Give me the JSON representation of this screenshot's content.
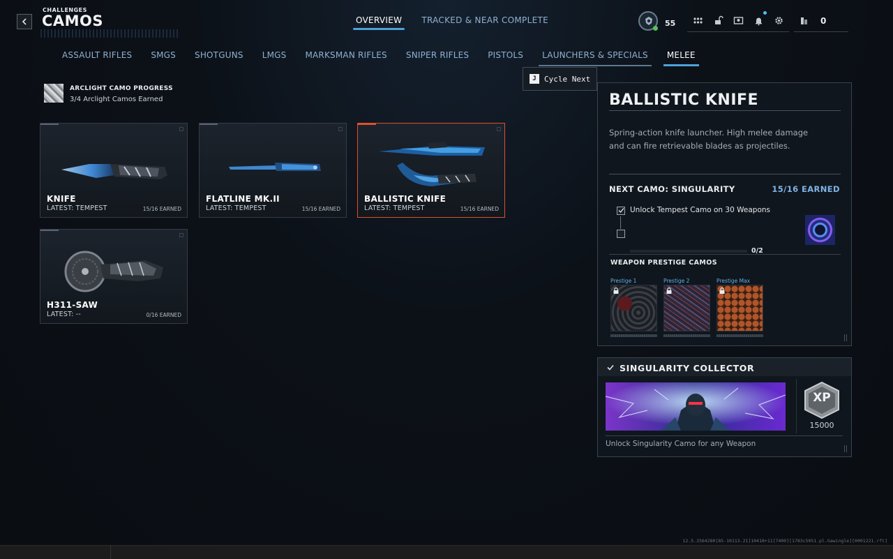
{
  "header": {
    "breadcrumb": "CHALLENGES",
    "title": "CAMOS",
    "tabs": [
      {
        "label": "OVERVIEW",
        "active": true
      },
      {
        "label": "TRACKED & NEAR COMPLETE",
        "active": false
      }
    ],
    "level": "55",
    "currency_count": "0",
    "icons": [
      "rank-emblem-icon",
      "grid-menu-icon",
      "unlock-icon",
      "profile-card-icon",
      "notification-bell-icon",
      "settings-gear-icon",
      "cod-points-icon"
    ]
  },
  "categories": [
    {
      "label": "ASSAULT RIFLES"
    },
    {
      "label": "SMGS"
    },
    {
      "label": "SHOTGUNS"
    },
    {
      "label": "LMGS"
    },
    {
      "label": "MARKSMAN RIFLES"
    },
    {
      "label": "SNIPER RIFLES"
    },
    {
      "label": "PISTOLS"
    },
    {
      "label": "LAUNCHERS & SPECIALS"
    },
    {
      "label": "MELEE",
      "active": true
    }
  ],
  "cycle_tip": {
    "key": "J",
    "label": "Cycle Next"
  },
  "arclight": {
    "title": "ARCLIGHT CAMO PROGRESS",
    "subtitle": "3/4 Arclight Camos Earned"
  },
  "weapons": [
    {
      "name": "KNIFE",
      "latest": "LATEST: TEMPEST",
      "earned": "15/16 EARNED"
    },
    {
      "name": "FLATLINE MK.II",
      "latest": "LATEST: TEMPEST",
      "earned": "15/16 EARNED"
    },
    {
      "name": "BALLISTIC KNIFE",
      "latest": "LATEST: TEMPEST",
      "earned": "15/16 EARNED",
      "selected": true
    },
    {
      "name": "H311-SAW",
      "latest": "LATEST: --",
      "earned": "0/16 EARNED"
    }
  ],
  "detail": {
    "title": "BALLISTIC KNIFE",
    "description": "Spring-action knife launcher. High melee damage and can fire retrievable blades as projectiles.",
    "next_camo": "NEXT CAMO: SINGULARITY",
    "next_earned": "15/16 EARNED",
    "task": "Unlock Tempest Camo on 30 Weapons",
    "task_progress_text": "0/2",
    "task_progress": 0,
    "prestige_header": "WEAPON PRESTIGE CAMOS",
    "prestige": [
      {
        "label": "Prestige 1"
      },
      {
        "label": "Prestige 2"
      },
      {
        "label": "Prestige Max"
      }
    ]
  },
  "collector": {
    "title": "SINGULARITY COLLECTOR",
    "xp_label": "XP",
    "xp_amount": "15000",
    "description": "Unlock Singularity Camo for any Weapon"
  },
  "build_info": "12.5.2564280[85-10113.21]10418+11[7400][1783c5051.pl.Gawingle][0001221.rft]",
  "colors": {
    "accent": "#4ca3d8",
    "selected": "#e0502c",
    "earned": "#7fb3e6",
    "prestige_label": "#5fb0e8"
  }
}
